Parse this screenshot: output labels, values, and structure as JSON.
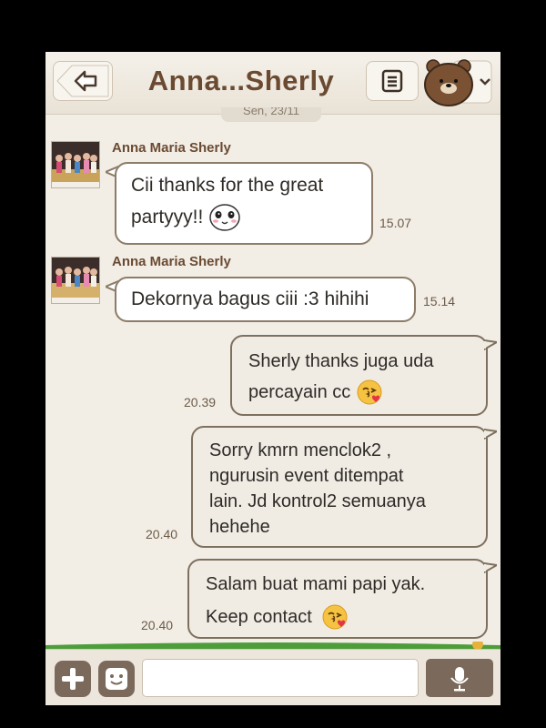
{
  "header": {
    "title": "Anna...Sherly",
    "back_icon": "back-arrow-icon",
    "menu_icon": "list-icon",
    "bear_icon": "bear-avatar-icon"
  },
  "date_separator": "Sen, 23/11",
  "messages": [
    {
      "from": "Anna Maria Sherly",
      "text_lines": [
        "Cii thanks for the great",
        "partyyy!!"
      ],
      "emoji": "panda-face-icon",
      "time": "15.07",
      "direction": "in"
    },
    {
      "from": "Anna Maria Sherly",
      "text_lines": [
        "Dekornya bagus ciii :3 hihihi"
      ],
      "time": "15.14",
      "direction": "in"
    },
    {
      "text_lines": [
        "Sherly thanks juga uda",
        "percayain cc"
      ],
      "emoji": "kiss-face-icon",
      "time": "20.39",
      "direction": "out"
    },
    {
      "text_lines": [
        "Sorry kmrn menclok2 ,",
        "ngurusin event ditempat",
        "lain. Jd kontrol2 semuanya",
        "hehehe"
      ],
      "time": "20.40",
      "direction": "out"
    },
    {
      "text_lines": [
        "Salam buat mami papi yak.",
        "Keep contact"
      ],
      "emoji": "kiss-face-icon",
      "time": "20.40",
      "direction": "out"
    }
  ],
  "input": {
    "placeholder": ""
  },
  "colors": {
    "accent": "#6b4a32",
    "button": "#7b695b",
    "background": "#f2eee6"
  }
}
